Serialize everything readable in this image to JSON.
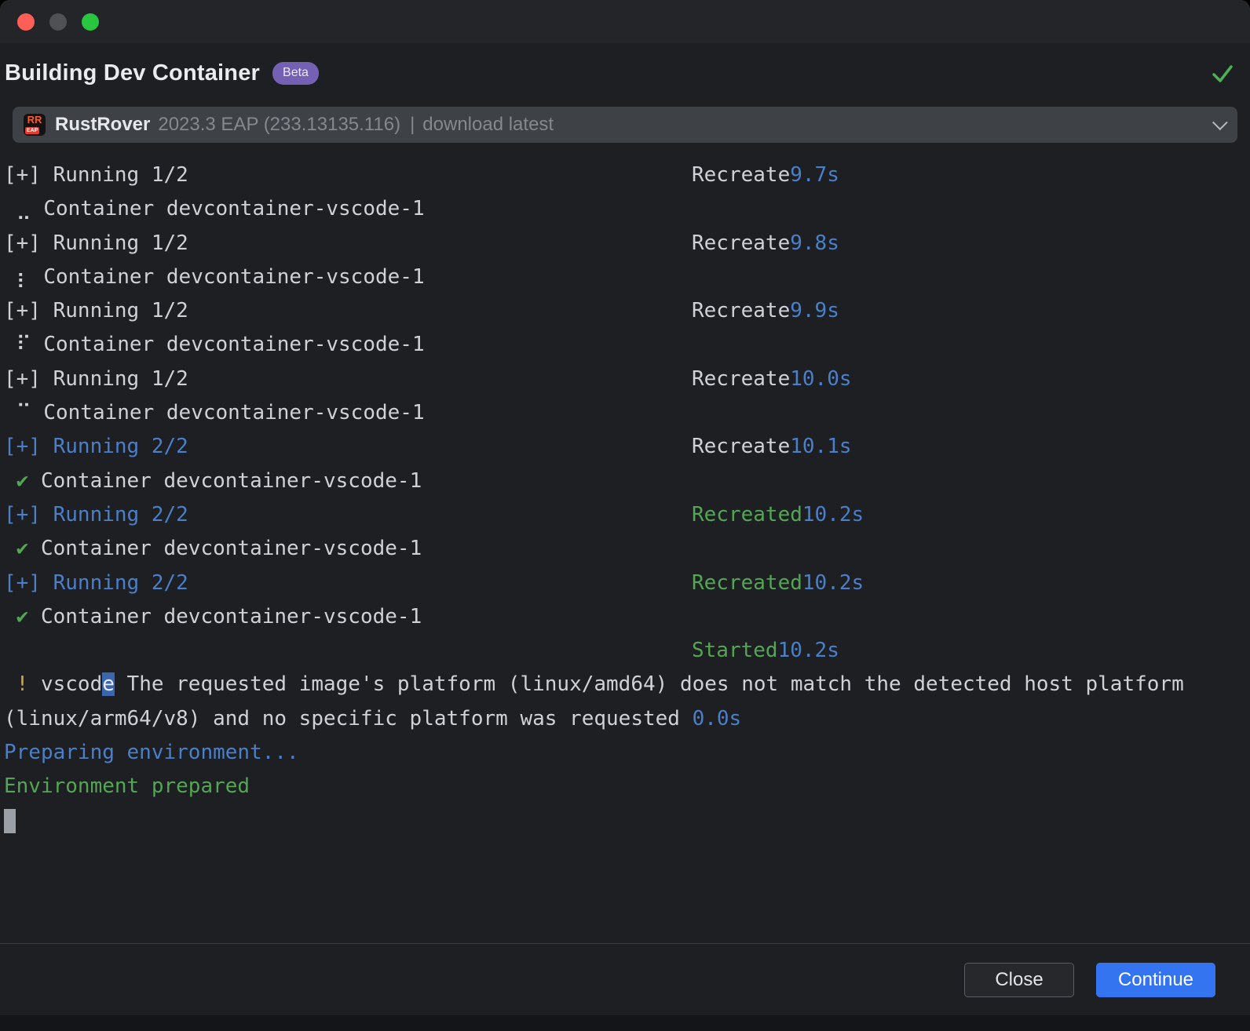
{
  "window": {
    "title": "Building Dev Container",
    "beta_badge": "Beta"
  },
  "ide_selector": {
    "product": "RustRover",
    "version": "2023.3 EAP (233.13135.116)",
    "separator": "|",
    "download_link": "download latest"
  },
  "icons": {
    "rustrover_logo": "RR",
    "rustrover_eap": "EAP",
    "success_check": "✓",
    "chevron_down": "⌄",
    "container_done_check": "✔"
  },
  "colors": {
    "accent_blue": "#3574f0",
    "log_blue": "#4a7fc9",
    "log_green": "#53a653",
    "log_yellow": "#d9a544",
    "beta_purple": "#7561b3",
    "success_green": "#4db052",
    "background": "#1d1f23"
  },
  "log": {
    "lines": [
      {
        "segments": [
          {
            "t": "[+] Running 1/2",
            "c": "fg"
          }
        ],
        "status": [
          {
            "t": "Recreate",
            "c": "fg"
          },
          {
            "t": "9.7s",
            "c": "blue"
          }
        ]
      },
      {
        "segments": [
          {
            "t": " ⣀ Container devcontainer-vscode-1",
            "c": "fg"
          }
        ]
      },
      {
        "segments": [
          {
            "t": "[+] Running 1/2",
            "c": "fg"
          }
        ],
        "status": [
          {
            "t": "Recreate",
            "c": "fg"
          },
          {
            "t": "9.8s",
            "c": "blue"
          }
        ]
      },
      {
        "segments": [
          {
            "t": " ⡆ Container devcontainer-vscode-1",
            "c": "fg"
          }
        ]
      },
      {
        "segments": [
          {
            "t": "[+] Running 1/2",
            "c": "fg"
          }
        ],
        "status": [
          {
            "t": "Recreate",
            "c": "fg"
          },
          {
            "t": "9.9s",
            "c": "blue"
          }
        ]
      },
      {
        "segments": [
          {
            "t": " ⠏ Container devcontainer-vscode-1",
            "c": "fg"
          }
        ]
      },
      {
        "segments": [
          {
            "t": "[+] Running 1/2",
            "c": "fg"
          }
        ],
        "status": [
          {
            "t": "Recreate",
            "c": "fg"
          },
          {
            "t": "10.0s",
            "c": "blue"
          }
        ]
      },
      {
        "segments": [
          {
            "t": " ⠉ Container devcontainer-vscode-1",
            "c": "fg"
          }
        ]
      },
      {
        "segments": [
          {
            "t": "[+] Running 2/2",
            "c": "blue"
          }
        ],
        "status": [
          {
            "t": "Recreate",
            "c": "fg"
          },
          {
            "t": "10.1s",
            "c": "blue"
          }
        ]
      },
      {
        "segments": [
          {
            "t": " ",
            "c": "fg"
          },
          {
            "t": "✔",
            "c": "green"
          },
          {
            "t": " Container devcontainer-vscode-1",
            "c": "fg"
          }
        ]
      },
      {
        "segments": [
          {
            "t": "[+] Running 2/2",
            "c": "blue"
          }
        ],
        "status": [
          {
            "t": "Recreated",
            "c": "green"
          },
          {
            "t": "10.2s",
            "c": "blue"
          }
        ]
      },
      {
        "segments": [
          {
            "t": " ",
            "c": "fg"
          },
          {
            "t": "✔",
            "c": "green"
          },
          {
            "t": " Container devcontainer-vscode-1",
            "c": "fg"
          }
        ]
      },
      {
        "segments": [
          {
            "t": "[+] Running 2/2",
            "c": "blue"
          }
        ],
        "status": [
          {
            "t": "Recreated",
            "c": "green"
          },
          {
            "t": "10.2s",
            "c": "blue"
          }
        ]
      },
      {
        "segments": [
          {
            "t": " ",
            "c": "fg"
          },
          {
            "t": "✔",
            "c": "green"
          },
          {
            "t": " Container devcontainer-vscode-1",
            "c": "fg"
          }
        ]
      },
      {
        "status": [
          {
            "t": "Started",
            "c": "green"
          },
          {
            "t": "10.2s",
            "c": "blue"
          }
        ]
      },
      {
        "segments": [
          {
            "t": " ",
            "c": "fg"
          },
          {
            "t": "!",
            "c": "yellow"
          },
          {
            "t": " vscod",
            "c": "fg"
          },
          {
            "t": "e",
            "c": "fg",
            "bg": "cursor"
          },
          {
            "t": " The requested image's platform (linux/amd64) does not match the detected host platform",
            "c": "fg"
          }
        ]
      },
      {
        "segments": [
          {
            "t": "(linux/arm64/v8) and no specific platform was requested ",
            "c": "fg"
          },
          {
            "t": "0.0s",
            "c": "blue"
          }
        ]
      },
      {
        "segments": [
          {
            "t": "Preparing environment...",
            "c": "blue"
          }
        ]
      },
      {
        "segments": [
          {
            "t": "Environment prepared",
            "c": "green"
          }
        ]
      },
      {
        "cursor": true
      }
    ]
  },
  "footer": {
    "close_label": "Close",
    "continue_label": "Continue"
  }
}
